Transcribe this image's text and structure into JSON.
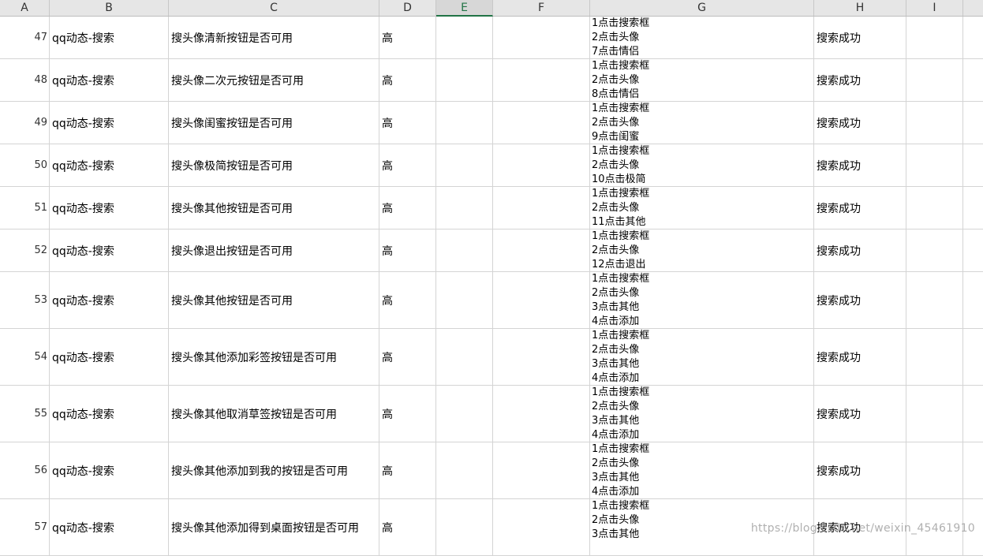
{
  "columns": [
    "A",
    "B",
    "C",
    "D",
    "E",
    "F",
    "G",
    "H",
    "I"
  ],
  "selected_column": "E",
  "rows": [
    {
      "num": "47",
      "module": "qq动态-搜索",
      "title": "搜头像清新按钮是否可用",
      "priority": "高",
      "steps": [
        "1点击搜索框",
        "2点击头像",
        "7点击情侣"
      ],
      "result": "搜索成功"
    },
    {
      "num": "48",
      "module": "qq动态-搜索",
      "title": "搜头像二次元按钮是否可用",
      "priority": "高",
      "steps": [
        "1点击搜索框",
        "2点击头像",
        "8点击情侣"
      ],
      "result": "搜索成功"
    },
    {
      "num": "49",
      "module": "qq动态-搜索",
      "title": "搜头像闺蜜按钮是否可用",
      "priority": "高",
      "steps": [
        "1点击搜索框",
        "2点击头像",
        "9点击闺蜜"
      ],
      "result": "搜索成功"
    },
    {
      "num": "50",
      "module": "qq动态-搜索",
      "title": "搜头像极简按钮是否可用",
      "priority": "高",
      "steps": [
        "1点击搜索框",
        "2点击头像",
        "10点击极简"
      ],
      "result": "搜索成功"
    },
    {
      "num": "51",
      "module": "qq动态-搜索",
      "title": "搜头像其他按钮是否可用",
      "priority": "高",
      "steps": [
        "1点击搜索框",
        "2点击头像",
        "11点击其他"
      ],
      "result": "搜索成功"
    },
    {
      "num": "52",
      "module": "qq动态-搜索",
      "title": "搜头像退出按钮是否可用",
      "priority": "高",
      "steps": [
        "1点击搜索框",
        "2点击头像",
        "12点击退出"
      ],
      "result": "搜索成功"
    },
    {
      "num": "53",
      "module": "qq动态-搜索",
      "title": "搜头像其他按钮是否可用",
      "priority": "高",
      "steps": [
        "1点击搜索框",
        "2点击头像",
        "3点击其他",
        "4点击添加"
      ],
      "result": "搜索成功"
    },
    {
      "num": "54",
      "module": "qq动态-搜索",
      "title": "搜头像其他添加彩签按钮是否可用",
      "priority": "高",
      "steps": [
        "1点击搜索框",
        "2点击头像",
        "3点击其他",
        "4点击添加"
      ],
      "result": "搜索成功"
    },
    {
      "num": "55",
      "module": "qq动态-搜索",
      "title": "搜头像其他取消草签按钮是否可用",
      "priority": "高",
      "steps": [
        "1点击搜索框",
        "2点击头像",
        "3点击其他",
        "4点击添加"
      ],
      "result": "搜索成功"
    },
    {
      "num": "56",
      "module": "qq动态-搜索",
      "title": "搜头像其他添加到我的按钮是否可用",
      "priority": "高",
      "steps": [
        "1点击搜索框",
        "2点击头像",
        "3点击其他",
        "4点击添加"
      ],
      "result": "搜索成功"
    },
    {
      "num": "57",
      "module": "qq动态-搜索",
      "title": "搜头像其他添加得到桌面按钮是否可用",
      "priority": "高",
      "steps": [
        "1点击搜索框",
        "2点击头像",
        "3点击其他"
      ],
      "result": "搜索成功"
    }
  ],
  "watermark": "https://blog.csdn.net/weixin_45461910"
}
